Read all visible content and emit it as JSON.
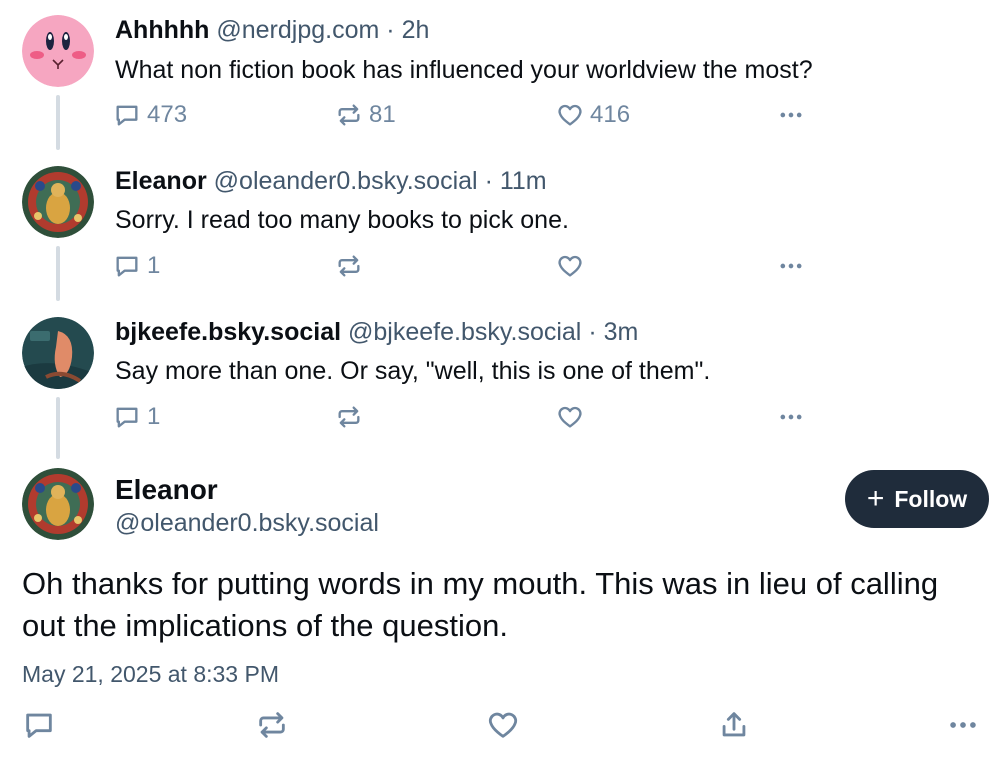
{
  "posts": [
    {
      "name": "Ahhhhh",
      "handle": "@nerdjpg.com",
      "time": "2h",
      "text": "What non fiction book has influenced your worldview the most?",
      "replies": "473",
      "reposts": "81",
      "likes": "416"
    },
    {
      "name": "Eleanor",
      "handle": "@oleander0.bsky.social",
      "time": "11m",
      "text": "Sorry. I read too many books to pick one.",
      "replies": "1",
      "reposts": "",
      "likes": ""
    },
    {
      "name": "bjkeefe.bsky.social",
      "handle": "@bjkeefe.bsky.social",
      "time": "3m",
      "text": "Say more than one. Or say, \"well, this is one of them\".",
      "replies": "1",
      "reposts": "",
      "likes": ""
    }
  ],
  "main_post": {
    "name": "Eleanor",
    "handle": "@oleander0.bsky.social",
    "text": "Oh thanks for putting words in my mouth. This was in lieu of calling out the implications of the question.",
    "date": "May 21, 2025 at 8:33 PM",
    "follow_label": "Follow"
  },
  "separator": "·",
  "colors": {
    "accent": "#1f2c3b",
    "secondary_text": "#42576c",
    "icon": "#6f869f",
    "thread_line": "#d4dbe2"
  },
  "icons": [
    "reply-icon",
    "repost-icon",
    "like-icon",
    "more-icon",
    "share-icon",
    "plus-icon"
  ]
}
